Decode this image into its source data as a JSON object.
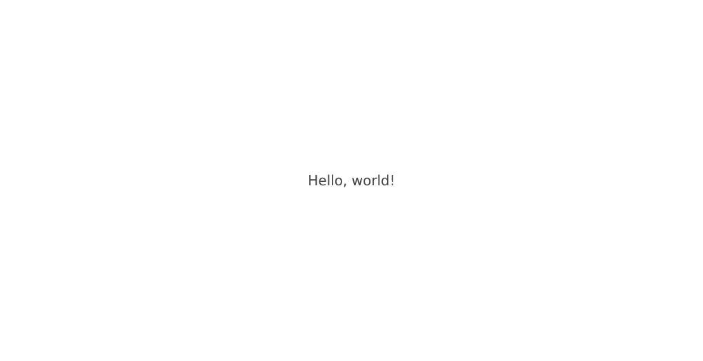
{
  "message": "Hello, world!"
}
